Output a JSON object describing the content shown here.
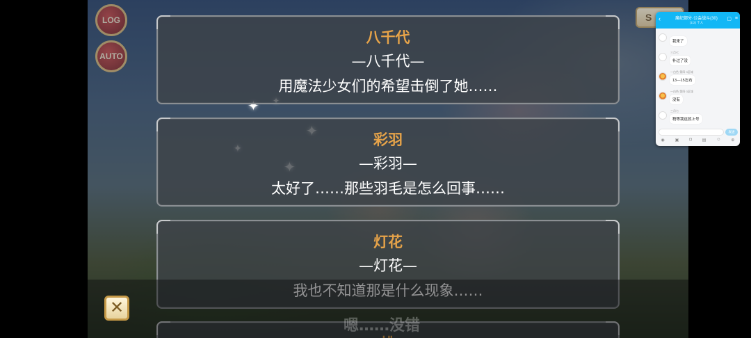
{
  "buttons": {
    "log_label": "LOG",
    "auto_label": "AUTO",
    "skip_label": "S",
    "close_glyph": "✕"
  },
  "log_entries": [
    {
      "speaker": "八千代",
      "line1": "—八千代—",
      "line2": "用魔法少女们的希望击倒了她……"
    },
    {
      "speaker": "彩羽",
      "line1": "—彩羽—",
      "line2": "太好了……那些羽毛是怎么回事……"
    },
    {
      "speaker": "灯花",
      "line1": "—灯花—",
      "line2": "我也不知道那是什么现象……"
    },
    {
      "speaker": "桃"
    }
  ],
  "dialogue_behind": "嗯……没错",
  "chat": {
    "title": "魔纪部分·公会战斗(30)",
    "subtitle": "(1/2) 个人",
    "messages": [
      {
        "meta": "",
        "text": "我来了"
      },
      {
        "meta": "三月七",
        "text": "补过了没"
      },
      {
        "meta": "一白色·第四·3区域",
        "text": "13—15左右"
      },
      {
        "meta": "一白色·第四·3区域",
        "text": "没有"
      },
      {
        "meta": "三月七",
        "text": "稍等我这就上号"
      }
    ],
    "send_label": "发送"
  },
  "colors": {
    "speaker": "#e6a349",
    "panel_border": "#8b8f93",
    "chat_header": "#12b7f5"
  }
}
